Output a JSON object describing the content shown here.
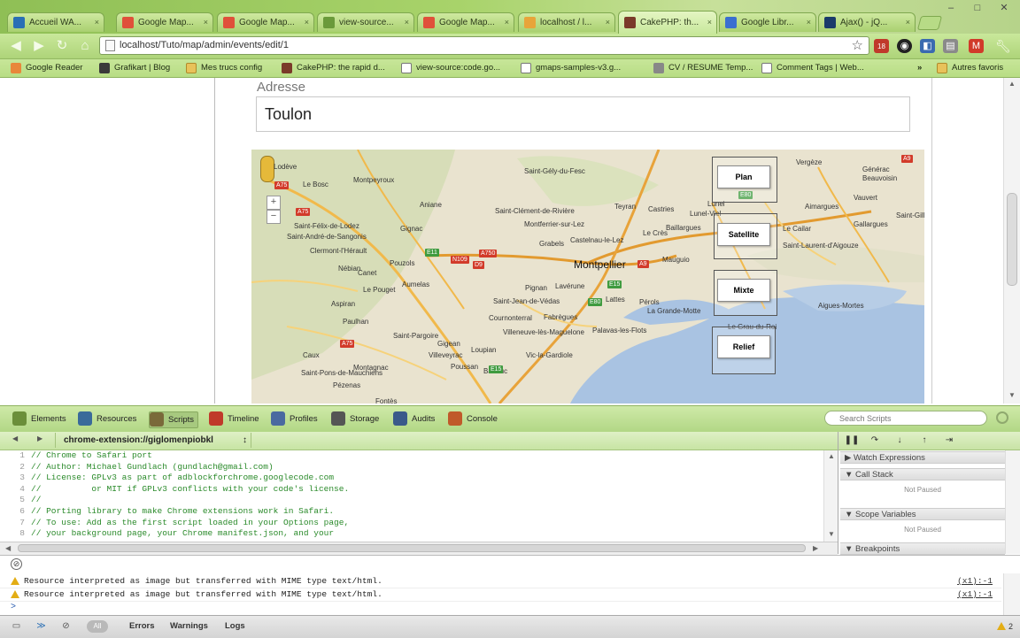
{
  "browser": {
    "tabs": [
      {
        "title": "Accueil WA...",
        "icon_color": "#2a6fb5"
      },
      {
        "title": "Google Map...",
        "icon_color": "#e0503a"
      },
      {
        "title": "Google Map...",
        "icon_color": "#e0503a"
      },
      {
        "title": "view-source...",
        "icon_color": "#6a9a3a"
      },
      {
        "title": "Google Map...",
        "icon_color": "#e0503a"
      },
      {
        "title": "localhost / l...",
        "icon_color": "#e8a43a"
      },
      {
        "title": "CakePHP: th...",
        "icon_color": "#7a3a2a",
        "active": true
      },
      {
        "title": "Google Libr...",
        "icon_color": "#3a6fd0"
      },
      {
        "title": "Ajax() - jQ...",
        "icon_color": "#1a3a6a"
      }
    ],
    "tab_close": "×",
    "window_controls": {
      "minimize": "–",
      "maximize": "□",
      "close": "✕"
    },
    "url": "localhost/Tuto/map/admin/events/edit/1",
    "extension_badges": {
      "count": "18"
    },
    "bookmarks": [
      {
        "label": "Google Reader",
        "kind": "app",
        "color": "#e8873a"
      },
      {
        "label": "Grafikart | Blog",
        "kind": "app",
        "color": "#3a3a3a"
      },
      {
        "label": "Mes trucs config",
        "kind": "folder"
      },
      {
        "label": "CakePHP: the rapid d...",
        "kind": "app",
        "color": "#7a3a2a"
      },
      {
        "label": "view-source:code.go...",
        "kind": "page"
      },
      {
        "label": "gmaps-samples-v3.g...",
        "kind": "page"
      },
      {
        "label": "CV / RESUME Temp...",
        "kind": "app",
        "color": "#888888"
      },
      {
        "label": "Comment Tags | Web...",
        "kind": "page"
      }
    ],
    "bookmarks_overflow": "»",
    "other_bookmarks": "Autres favoris"
  },
  "form": {
    "adresse_label": "Adresse",
    "adresse_value": "Toulon"
  },
  "map": {
    "cities": [
      {
        "name": "Montpellier",
        "size": "big"
      },
      {
        "name": "Le Bosc"
      },
      {
        "name": "Lodève"
      },
      {
        "name": "Montpeyroux"
      },
      {
        "name": "Aniane"
      },
      {
        "name": "Saint-Gély-du-Fesc"
      },
      {
        "name": "Saint-Clément-de-Rivière"
      },
      {
        "name": "Teyran"
      },
      {
        "name": "Castries"
      },
      {
        "name": "Lunel-Viel"
      },
      {
        "name": "Lunel"
      },
      {
        "name": "Montferrier-sur-Lez"
      },
      {
        "name": "Grabels"
      },
      {
        "name": "Castelnau-le-Lez"
      },
      {
        "name": "Le Crès"
      },
      {
        "name": "Baillargues"
      },
      {
        "name": "Mauguio"
      },
      {
        "name": "Saint-André-de-Sangonis"
      },
      {
        "name": "Clermont-l'Hérault"
      },
      {
        "name": "Gignac"
      },
      {
        "name": "Saint-Félix-de-Lodez"
      },
      {
        "name": "Nébian"
      },
      {
        "name": "Canet"
      },
      {
        "name": "Pouzols"
      },
      {
        "name": "Le Pouget"
      },
      {
        "name": "Aumelas"
      },
      {
        "name": "Pignan"
      },
      {
        "name": "Lavérune"
      },
      {
        "name": "Lattes"
      },
      {
        "name": "Pérols"
      },
      {
        "name": "Saint-Jean-de-Védas"
      },
      {
        "name": "Cournonterral"
      },
      {
        "name": "Fabrègues"
      },
      {
        "name": "Villeneuve-lès-Maguelone"
      },
      {
        "name": "Palavas-les-Flots"
      },
      {
        "name": "La Grande-Motte"
      },
      {
        "name": "Le Grau-du-Roi"
      },
      {
        "name": "Paulhan"
      },
      {
        "name": "Saint-Pargoire"
      },
      {
        "name": "Gigean"
      },
      {
        "name": "Villeveyrac"
      },
      {
        "name": "Poussan"
      },
      {
        "name": "Balaruc"
      },
      {
        "name": "Montagnac"
      },
      {
        "name": "Pézenas"
      },
      {
        "name": "Caux"
      },
      {
        "name": "Aigues-Mortes"
      },
      {
        "name": "Vauvert"
      },
      {
        "name": "Beauvoisin"
      },
      {
        "name": "Générac"
      },
      {
        "name": "Saint-Laurent-d'Aigouze"
      },
      {
        "name": "Vergèze"
      },
      {
        "name": "Aimargues"
      },
      {
        "name": "Gallargues"
      },
      {
        "name": "Le Cailar"
      },
      {
        "name": "Saint-Gilles"
      },
      {
        "name": "Aspiran"
      },
      {
        "name": "Loupian"
      },
      {
        "name": "Saint-Pons-de-Mauchiens"
      },
      {
        "name": "Fontès"
      },
      {
        "name": "Vic-la-Gardiole"
      }
    ],
    "highways": [
      {
        "label": "A75",
        "kind": "r"
      },
      {
        "label": "A75",
        "kind": "r"
      },
      {
        "label": "E11",
        "kind": "g"
      },
      {
        "label": "N109",
        "kind": "r"
      },
      {
        "label": "A750",
        "kind": "r"
      },
      {
        "label": "A9",
        "kind": "r"
      },
      {
        "label": "E15",
        "kind": "g"
      },
      {
        "label": "E80",
        "kind": "g"
      },
      {
        "label": "E15",
        "kind": "g"
      },
      {
        "label": "E80",
        "kind": "g"
      },
      {
        "label": "A9",
        "kind": "r"
      },
      {
        "label": "A75",
        "kind": "r"
      },
      {
        "label": "D9",
        "kind": "r"
      }
    ],
    "map_types": {
      "plan": "Plan",
      "satellite": "Satellite",
      "mixte": "Mixte",
      "relief": "Relief"
    },
    "zoom_in": "+",
    "zoom_out": "−"
  },
  "devtools": {
    "tabs": [
      {
        "label": "Elements",
        "color": "#6b8f3a"
      },
      {
        "label": "Resources",
        "color": "#3a6a9a"
      },
      {
        "label": "Scripts",
        "color": "#7a6a3a",
        "active": true
      },
      {
        "label": "Timeline",
        "color": "#c03a2a"
      },
      {
        "label": "Profiles",
        "color": "#4a6aa0"
      },
      {
        "label": "Storage",
        "color": "#555555"
      },
      {
        "label": "Audits",
        "color": "#3a5a8a"
      },
      {
        "label": "Console",
        "color": "#c05a2a"
      }
    ],
    "search_placeholder": "Search Scripts",
    "script_name": "chrome-extension://giglomenpiobkl",
    "script_sel_arrow": "↕",
    "nav_back": "◀",
    "nav_fwd": "▶",
    "code_lines": [
      {
        "n": "1",
        "text": "// Chrome to Safari port"
      },
      {
        "n": "2",
        "text": "// Author: Michael Gundlach (gundlach@gmail.com)"
      },
      {
        "n": "3",
        "text": "// License: GPLv3 as part of adblockforchrome.googlecode.com"
      },
      {
        "n": "4",
        "text": "//          or MIT if GPLv3 conflicts with your code's license."
      },
      {
        "n": "5",
        "text": "//"
      },
      {
        "n": "6",
        "text": "// Porting library to make Chrome extensions work in Safari."
      },
      {
        "n": "7",
        "text": "// To use: Add as the first script loaded in your Options page,"
      },
      {
        "n": "8",
        "text": "// your background page, your Chrome manifest.json, and your"
      }
    ],
    "debugger_buttons": {
      "pause": "❚❚",
      "step_over": "↷",
      "step_into": "↓",
      "step_out": "↑",
      "deactivate": "⇥"
    },
    "sections": [
      {
        "title": "▶ Watch Expressions"
      },
      {
        "title": "▼ Call Stack",
        "status": "Not Paused"
      },
      {
        "title": "▼ Scope Variables",
        "status": "Not Paused"
      },
      {
        "title": "▼ Breakpoints"
      }
    ],
    "console": {
      "clear": "⊘",
      "messages": [
        {
          "text": "Resource interpreted as image but transferred with MIME type text/html.",
          "source": "(x1):-1"
        },
        {
          "text": "Resource interpreted as image but transferred with MIME type text/html.",
          "source": "(x1):-1"
        }
      ],
      "prompt": ">"
    },
    "status_bar": {
      "all_label": "All",
      "filters": [
        "Errors",
        "Warnings",
        "Logs"
      ],
      "warning_count": "2"
    }
  }
}
